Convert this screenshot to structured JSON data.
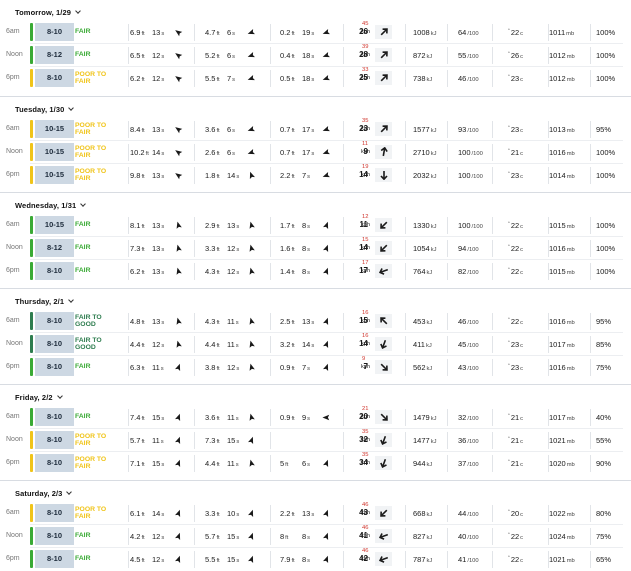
{
  "colors": {
    "fair": "#3aaa35",
    "poor_to_fair": "#f0c419",
    "fair_to_good": "#2e7d4f",
    "gust": "#d0342c",
    "size_box": "#cdd8e3"
  },
  "units": {
    "ft": "ft",
    "s": "s",
    "kph": "kph",
    "kj": "kJ",
    "score": "/100",
    "deg": "°",
    "c": "c",
    "mb": "mb",
    "pct": "%"
  },
  "days": [
    {
      "title": "Tomorrow, 1/29",
      "rows": [
        {
          "time": "6am",
          "size": "8-10",
          "rating": "FAIR",
          "r": "fair",
          "p1": "6.9",
          "p1p": "13",
          "p1d": 305,
          "p2": "4.7",
          "p2p": "6",
          "p2d": 250,
          "p3": "0.2",
          "p3p": "19",
          "p3d": 250,
          "wind": "26",
          "gust": "45",
          "wdir": 45,
          "energy": "1008",
          "score": "64",
          "temp": "22",
          "pres": "1011",
          "pct": "100%"
        },
        {
          "time": "Noon",
          "size": "8-12",
          "rating": "FAIR",
          "r": "fair",
          "p1": "6.5",
          "p1p": "12",
          "p1d": 305,
          "p2": "5.2",
          "p2p": "6",
          "p2d": 250,
          "p3": "0.4",
          "p3p": "18",
          "p3d": 250,
          "wind": "28",
          "gust": "39",
          "wdir": 45,
          "energy": "872",
          "score": "55",
          "temp": "26",
          "pres": "1012",
          "pct": "100%"
        },
        {
          "time": "6pm",
          "size": "8-10",
          "rating": "POOR TO FAIR",
          "r": "poor_to_fair",
          "p1": "6.2",
          "p1p": "12",
          "p1d": 305,
          "p2": "5.5",
          "p2p": "7",
          "p2d": 250,
          "p3": "0.5",
          "p3p": "18",
          "p3d": 250,
          "wind": "25",
          "gust": "33",
          "wdir": 45,
          "energy": "738",
          "score": "46",
          "temp": "23",
          "pres": "1012",
          "pct": "100%"
        }
      ]
    },
    {
      "title": "Tuesday, 1/30",
      "rows": [
        {
          "time": "6am",
          "size": "10-15",
          "rating": "POOR TO FAIR",
          "r": "poor_to_fair",
          "p1": "8.4",
          "p1p": "13",
          "p1d": 305,
          "p2": "3.6",
          "p2p": "6",
          "p2d": 250,
          "p3": "0.7",
          "p3p": "17",
          "p3d": 250,
          "wind": "23",
          "gust": "35",
          "wdir": 45,
          "energy": "1577",
          "score": "93",
          "temp": "23",
          "pres": "1013",
          "pct": "95%"
        },
        {
          "time": "Noon",
          "size": "10-15",
          "rating": "POOR TO FAIR",
          "r": "poor_to_fair",
          "p1": "10.2",
          "p1p": "14",
          "p1d": 305,
          "p2": "2.6",
          "p2p": "6",
          "p2d": 250,
          "p3": "0.7",
          "p3p": "17",
          "p3d": 250,
          "wind": "9",
          "gust": "11",
          "wdir": 10,
          "energy": "2710",
          "score": "100",
          "temp": "21",
          "pres": "1016",
          "pct": "100%"
        },
        {
          "time": "6pm",
          "size": "10-15",
          "rating": "POOR TO FAIR",
          "r": "poor_to_fair",
          "p1": "9.8",
          "p1p": "13",
          "p1d": 305,
          "p2": "1.8",
          "p2p": "14",
          "p2d": 340,
          "p3": "2.2",
          "p3p": "7",
          "p3d": 250,
          "wind": "14",
          "gust": "19",
          "wdir": 180,
          "energy": "2032",
          "score": "100",
          "temp": "23",
          "pres": "1014",
          "pct": "100%"
        }
      ]
    },
    {
      "title": "Wednesday, 1/31",
      "rows": [
        {
          "time": "6am",
          "size": "10-15",
          "rating": "FAIR",
          "r": "fair",
          "p1": "8.1",
          "p1p": "13",
          "p1d": 345,
          "p2": "2.9",
          "p2p": "13",
          "p2d": 345,
          "p3": "1.7",
          "p3p": "8",
          "p3d": 20,
          "wind": "11",
          "gust": "12",
          "wdir": 225,
          "energy": "1330",
          "score": "100",
          "temp": "22",
          "pres": "1015",
          "pct": "100%"
        },
        {
          "time": "Noon",
          "size": "8-12",
          "rating": "FAIR",
          "r": "fair",
          "p1": "7.3",
          "p1p": "13",
          "p1d": 345,
          "p2": "3.3",
          "p2p": "12",
          "p2d": 345,
          "p3": "1.6",
          "p3p": "8",
          "p3d": 20,
          "wind": "14",
          "gust": "15",
          "wdir": 225,
          "energy": "1054",
          "score": "94",
          "temp": "22",
          "pres": "1016",
          "pct": "100%"
        },
        {
          "time": "6pm",
          "size": "8-10",
          "rating": "FAIR",
          "r": "fair",
          "p1": "6.2",
          "p1p": "13",
          "p1d": 345,
          "p2": "4.3",
          "p2p": "12",
          "p2d": 345,
          "p3": "1.4",
          "p3p": "8",
          "p3d": 20,
          "wind": "17",
          "gust": "17",
          "wdir": 250,
          "energy": "764",
          "score": "82",
          "temp": "22",
          "pres": "1015",
          "pct": "100%"
        }
      ]
    },
    {
      "title": "Thursday, 2/1",
      "rows": [
        {
          "time": "6am",
          "size": "8-10",
          "rating": "FAIR TO GOOD",
          "r": "fair_to_good",
          "p1": "4.8",
          "p1p": "13",
          "p1d": 345,
          "p2": "4.3",
          "p2p": "11",
          "p2d": 345,
          "p3": "2.5",
          "p3p": "13",
          "p3d": 20,
          "wind": "15",
          "gust": "16",
          "wdir": 315,
          "energy": "453",
          "score": "46",
          "temp": "22",
          "pres": "1016",
          "pct": "95%"
        },
        {
          "time": "Noon",
          "size": "8-10",
          "rating": "FAIR TO GOOD",
          "r": "fair_to_good",
          "p1": "4.4",
          "p1p": "12",
          "p1d": 345,
          "p2": "4.4",
          "p2p": "11",
          "p2d": 345,
          "p3": "3.2",
          "p3p": "14",
          "p3d": 20,
          "wind": "14",
          "gust": "16",
          "wdir": 200,
          "energy": "411",
          "score": "45",
          "temp": "23",
          "pres": "1017",
          "pct": "85%"
        },
        {
          "time": "6pm",
          "size": "8-10",
          "rating": "FAIR",
          "r": "fair",
          "p1": "6.3",
          "p1p": "11",
          "p1d": 20,
          "p2": "3.8",
          "p2p": "12",
          "p2d": 345,
          "p3": "0.9",
          "p3p": "7",
          "p3d": 20,
          "wind": "7",
          "gust": "9",
          "wdir": 135,
          "energy": "562",
          "score": "43",
          "temp": "23",
          "pres": "1016",
          "pct": "75%"
        }
      ]
    },
    {
      "title": "Friday, 2/2",
      "rows": [
        {
          "time": "6am",
          "size": "8-10",
          "rating": "FAIR",
          "r": "fair",
          "p1": "7.4",
          "p1p": "15",
          "p1d": 20,
          "p2": "3.6",
          "p2p": "11",
          "p2d": 345,
          "p3": "0.9",
          "p3p": "9",
          "p3d": 270,
          "wind": "20",
          "gust": "21",
          "wdir": 135,
          "energy": "1479",
          "score": "32",
          "temp": "21",
          "pres": "1017",
          "pct": "40%"
        },
        {
          "time": "Noon",
          "size": "8-10",
          "rating": "POOR TO FAIR",
          "r": "poor_to_fair",
          "p1": "5.7",
          "p1p": "11",
          "p1d": 20,
          "p2": "7.3",
          "p2p": "15",
          "p2d": 20,
          "p3": "",
          "p3p": "",
          "p3d": null,
          "wind": "32",
          "gust": "35",
          "wdir": 200,
          "energy": "1477",
          "score": "36",
          "temp": "21",
          "pres": "1021",
          "pct": "55%"
        },
        {
          "time": "6pm",
          "size": "8-10",
          "rating": "POOR TO FAIR",
          "r": "poor_to_fair",
          "p1": "7.1",
          "p1p": "15",
          "p1d": 20,
          "p2": "4.4",
          "p2p": "11",
          "p2d": 345,
          "p3": "5",
          "p3p": "6",
          "p3d": 20,
          "wind": "34",
          "gust": "35",
          "wdir": 200,
          "energy": "944",
          "score": "37",
          "temp": "21",
          "pres": "1020",
          "pct": "90%"
        }
      ]
    },
    {
      "title": "Saturday, 2/3",
      "rows": [
        {
          "time": "6am",
          "size": "8-10",
          "rating": "POOR TO FAIR",
          "r": "poor_to_fair",
          "p1": "6.1",
          "p1p": "14",
          "p1d": 20,
          "p2": "3.3",
          "p2p": "10",
          "p2d": 20,
          "p3": "2.2",
          "p3p": "13",
          "p3d": 20,
          "wind": "43",
          "gust": "46",
          "wdir": 225,
          "energy": "668",
          "score": "44",
          "temp": "20",
          "pres": "1022",
          "pct": "80%"
        },
        {
          "time": "Noon",
          "size": "8-10",
          "rating": "FAIR",
          "r": "fair",
          "p1": "4.2",
          "p1p": "12",
          "p1d": 20,
          "p2": "5.7",
          "p2p": "15",
          "p2d": 20,
          "p3": "8",
          "p3p": "8",
          "p3d": 20,
          "wind": "41",
          "gust": "46",
          "wdir": 250,
          "energy": "827",
          "score": "40",
          "temp": "22",
          "pres": "1024",
          "pct": "75%"
        },
        {
          "time": "6pm",
          "size": "8-10",
          "rating": "FAIR",
          "r": "fair",
          "p1": "4.5",
          "p1p": "12",
          "p1d": 20,
          "p2": "5.5",
          "p2p": "15",
          "p2d": 20,
          "p3": "7.9",
          "p3p": "8",
          "p3d": 20,
          "wind": "42",
          "gust": "46",
          "wdir": 250,
          "energy": "787",
          "score": "41",
          "temp": "22",
          "pres": "1021",
          "pct": "65%"
        }
      ]
    }
  ]
}
